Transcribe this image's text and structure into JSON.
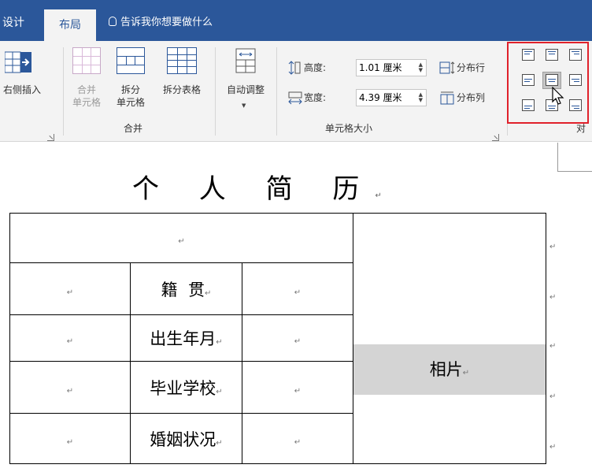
{
  "tabs": {
    "design": "设计",
    "layout": "布局"
  },
  "tellme": "告诉我你想要做什么",
  "ribbon": {
    "insert_right": "右侧插入",
    "merge": {
      "merge_cells_line1": "合并",
      "merge_cells_line2": "单元格",
      "split_cells_line1": "拆分",
      "split_cells_line2": "单元格",
      "split_table": "拆分表格",
      "group": "合并"
    },
    "autofit": "自动调整",
    "cellsize": {
      "height_label": "高度:",
      "height_value": "1.01 厘米",
      "width_label": "宽度:",
      "width_value": "4.39 厘米",
      "distribute_rows": "分布行",
      "distribute_cols": "分布列",
      "group": "单元格大小"
    },
    "align_group_partial": "对"
  },
  "document": {
    "title": "个 人 简 历",
    "para_mark": "↵",
    "rows": [
      {
        "label": ""
      },
      {
        "label": "籍  贯"
      },
      {
        "label": "出生年月"
      },
      {
        "label": "毕业学校"
      },
      {
        "label": "婚姻状况"
      }
    ],
    "photo": "相片"
  }
}
